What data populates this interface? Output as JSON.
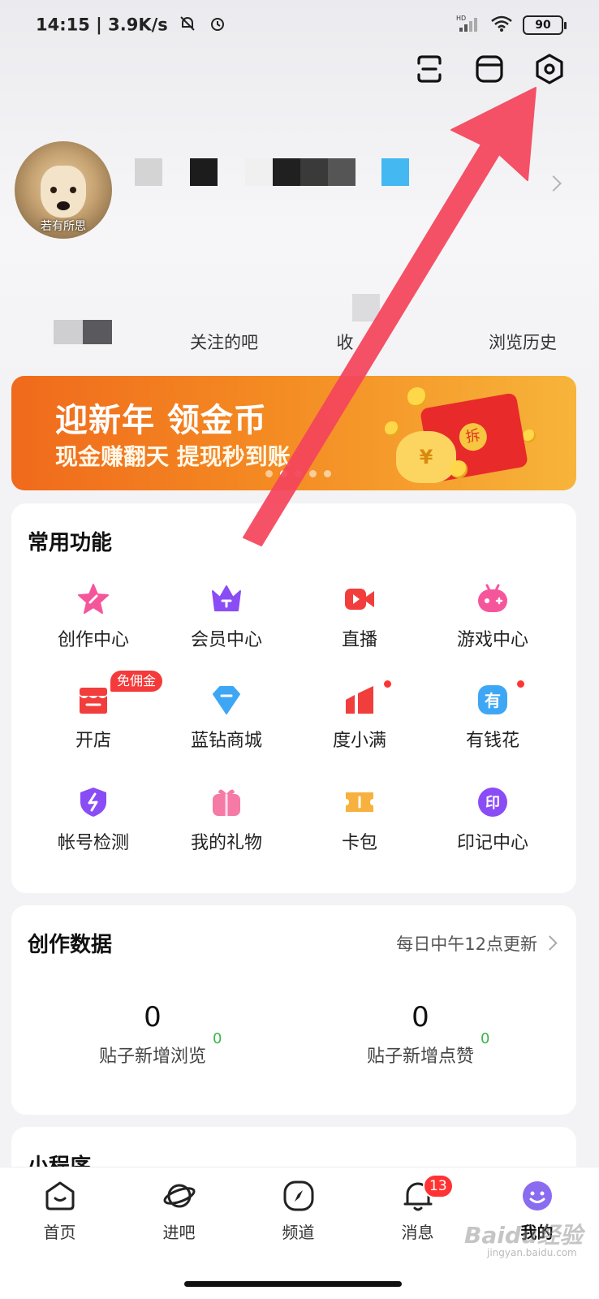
{
  "status_bar": {
    "time": "14:15",
    "speed": "3.9K/s",
    "battery": "90",
    "network": "HD"
  },
  "header": {
    "icons": [
      "scan-icon",
      "wardrobe-icon",
      "settings-icon"
    ]
  },
  "profile": {
    "avatar_caption": "若有所思"
  },
  "stats": {
    "items": [
      {
        "label": ""
      },
      {
        "label": "关注的吧"
      },
      {
        "label": "收"
      },
      {
        "label": "浏览历史"
      }
    ]
  },
  "banner": {
    "title": "迎新年 领金币",
    "subtitle": "现金赚翻天 提现秒到账",
    "packet_char": "拆",
    "bag_char": "¥"
  },
  "functions": {
    "title": "常用功能",
    "items": [
      {
        "label": "创作中心",
        "icon": "star-pen-icon",
        "color": "#f5569b"
      },
      {
        "label": "会员中心",
        "icon": "crown-icon",
        "color": "#8a4cf5"
      },
      {
        "label": "直播",
        "icon": "video-camera-icon",
        "color": "#f23d3d"
      },
      {
        "label": "游戏中心",
        "icon": "gamepad-icon",
        "color": "#f5569b"
      },
      {
        "label": "开店",
        "icon": "shop-icon",
        "color": "#f23d3d",
        "tag": "免佣金"
      },
      {
        "label": "蓝钻商城",
        "icon": "diamond-icon",
        "color": "#3ea7f5"
      },
      {
        "label": "度小满",
        "icon": "chart-bars-icon",
        "color": "#f23d3d",
        "dot": true
      },
      {
        "label": "有钱花",
        "icon": "you-char-icon",
        "color": "#3ea7f5",
        "dot": true,
        "glyph": "有"
      },
      {
        "label": "帐号检测",
        "icon": "shield-icon",
        "color": "#8a4cf5"
      },
      {
        "label": "我的礼物",
        "icon": "gift-icon",
        "color": "#f57aa5"
      },
      {
        "label": "卡包",
        "icon": "ticket-icon",
        "color": "#f7b13e"
      },
      {
        "label": "印记中心",
        "icon": "yin-char-icon",
        "color": "#8a4cf5",
        "glyph": "印"
      }
    ]
  },
  "creation": {
    "title": "创作数据",
    "update_note": "每日中午12点更新",
    "metrics": [
      {
        "value": "0",
        "delta": "0",
        "label": "贴子新增浏览"
      },
      {
        "value": "0",
        "delta": "0",
        "label": "贴子新增点赞"
      }
    ]
  },
  "mini_programs": {
    "title": "小程序"
  },
  "bottom_nav": {
    "items": [
      {
        "label": "首页",
        "icon": "home-icon"
      },
      {
        "label": "进吧",
        "icon": "planet-icon"
      },
      {
        "label": "频道",
        "icon": "compass-icon"
      },
      {
        "label": "消息",
        "icon": "bell-icon",
        "badge": "13"
      },
      {
        "label": "我的",
        "icon": "smiley-icon",
        "active": true
      }
    ]
  },
  "watermark": {
    "text": "Baidu经验",
    "sub": "jingyan.baidu.com"
  },
  "colors": {
    "accent_arrow": "#f5455c",
    "active_nav": "#8a6cf0",
    "green_delta": "#3bb54a"
  }
}
